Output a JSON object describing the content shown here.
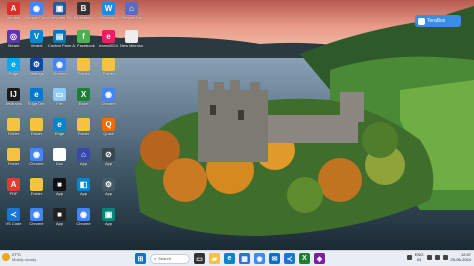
{
  "desktop": {
    "icons": [
      {
        "label": "Acrobat",
        "color": "#d93025",
        "glyph": "A",
        "icon": "pdf-icon"
      },
      {
        "label": "Google Chrome",
        "color": "#4285f4",
        "glyph": "◉",
        "icon": "chrome-icon"
      },
      {
        "label": "Computer Fest",
        "color": "#2b579a",
        "glyph": "▣",
        "icon": "app-icon"
      },
      {
        "label": "Bluestacks",
        "color": "#333333",
        "glyph": "B",
        "icon": "bluestacks-icon"
      },
      {
        "label": "WhatsApp",
        "color": "#1e88e5",
        "glyph": "W",
        "icon": "app-icon"
      },
      {
        "label": "Recycle Bin",
        "color": "#5c6bc0",
        "glyph": "⌂",
        "icon": "recycle-bin-icon"
      },
      {
        "label": "Steam",
        "color": "#5e35b1",
        "glyph": "◎",
        "icon": "steam-icon"
      },
      {
        "label": "Vivaldi",
        "color": "#0288d1",
        "glyph": "V",
        "icon": "app-icon"
      },
      {
        "label": "Control Panel",
        "color": "#0277bd",
        "glyph": "▤",
        "icon": "control-panel-icon"
      },
      {
        "label": "A. Facebook",
        "color": "#4caf50",
        "glyph": "f",
        "icon": "app-icon"
      },
      {
        "label": "exam2024",
        "color": "#e91e63",
        "glyph": "e",
        "icon": "folder-icon"
      },
      {
        "label": "New Microsoft",
        "color": "#eeeeee",
        "glyph": "",
        "icon": "document-icon"
      },
      {
        "label": "Edge",
        "color": "#03a9f4",
        "glyph": "e",
        "icon": "edge-icon"
      },
      {
        "label": "Settings",
        "color": "#0d47a1",
        "glyph": "⚙",
        "icon": "settings-icon"
      },
      {
        "label": "Chrome",
        "color": "#4285f4",
        "glyph": "◉",
        "icon": "chrome-icon"
      },
      {
        "label": "Folder",
        "color": "#f5c242",
        "glyph": "",
        "icon": "folder-icon"
      },
      {
        "label": "Folder",
        "color": "#f5c242",
        "glyph": "",
        "icon": "folder-icon"
      },
      {
        "label": "JetBrains",
        "color": "#1a1a1a",
        "glyph": "IJ",
        "icon": "jetbrains-icon"
      },
      {
        "label": "Edge Dev",
        "color": "#0078d4",
        "glyph": "e",
        "icon": "edge-icon"
      },
      {
        "label": "File",
        "color": "#90caf9",
        "glyph": "▭",
        "icon": "app-icon"
      },
      {
        "label": "Excel",
        "color": "#1e7e34",
        "glyph": "X",
        "icon": "excel-icon"
      },
      {
        "label": "Chrome",
        "color": "#4285f4",
        "glyph": "◉",
        "icon": "chrome-icon"
      },
      {
        "label": "Folder",
        "color": "#f5c242",
        "glyph": "",
        "icon": "folder-icon"
      },
      {
        "label": "Folder",
        "color": "#f5c242",
        "glyph": "",
        "icon": "folder-icon"
      },
      {
        "label": "Edge",
        "color": "#0a84c9",
        "glyph": "e",
        "icon": "edge-icon"
      },
      {
        "label": "Folder",
        "color": "#f5c242",
        "glyph": "",
        "icon": "folder-icon"
      },
      {
        "label": "Quick",
        "color": "#ef6c00",
        "glyph": "Q",
        "icon": "app-icon"
      },
      {
        "label": "Folder",
        "color": "#f5c242",
        "glyph": "",
        "icon": "folder-icon"
      },
      {
        "label": "Chrome",
        "color": "#4285f4",
        "glyph": "◉",
        "icon": "chrome-icon"
      },
      {
        "label": "Doc",
        "color": "#ffffff",
        "glyph": "",
        "icon": "document-icon"
      },
      {
        "label": "App",
        "color": "#3949ab",
        "glyph": "⌂",
        "icon": "app-icon"
      },
      {
        "label": "App",
        "color": "#37474f",
        "glyph": "⊘",
        "icon": "app-icon"
      },
      {
        "label": "PDF",
        "color": "#e53935",
        "glyph": "A",
        "icon": "pdf-icon"
      },
      {
        "label": "Folder",
        "color": "#f5c242",
        "glyph": "",
        "icon": "folder-icon"
      },
      {
        "label": "App",
        "color": "#111111",
        "glyph": "■",
        "icon": "app-icon"
      },
      {
        "label": "App",
        "color": "#0288d1",
        "glyph": "◧",
        "icon": "app-icon"
      },
      {
        "label": "App",
        "color": "#455a64",
        "glyph": "⚙",
        "icon": "app-icon"
      },
      {
        "label": "VS Code",
        "color": "#1976d2",
        "glyph": "≺",
        "icon": "vscode-icon"
      },
      {
        "label": "Chrome",
        "color": "#4285f4",
        "glyph": "◉",
        "icon": "chrome-icon"
      },
      {
        "label": "App",
        "color": "#212121",
        "glyph": "■",
        "icon": "app-icon"
      },
      {
        "label": "Chrome",
        "color": "#4285f4",
        "glyph": "◉",
        "icon": "chrome-icon"
      },
      {
        "label": "App",
        "color": "#00897b",
        "glyph": "▣",
        "icon": "app-icon"
      },
      {
        "label": "App",
        "color": "#1565c0",
        "glyph": "▭",
        "icon": "app-icon"
      },
      {
        "label": "Chrome",
        "color": "#4285f4",
        "glyph": "◉",
        "icon": "chrome-icon"
      },
      {
        "label": "Chart",
        "color": "#fdd835",
        "glyph": "▮",
        "icon": "chart-icon"
      }
    ]
  },
  "terabox": {
    "label": "TeraBox",
    "icon": "terabox-icon"
  },
  "taskbar": {
    "weather": {
      "temp": "27°C",
      "condition": "Mostly cloudy"
    },
    "search_placeholder": "Search",
    "apps": [
      {
        "name": "start",
        "glyph": "⊞",
        "color": "#0078d4",
        "icon": "windows-start-icon"
      },
      {
        "name": "task-view",
        "glyph": "▭",
        "color": "#333333",
        "icon": "task-view-icon"
      },
      {
        "name": "file-explorer",
        "glyph": "▰",
        "color": "#f5c242",
        "icon": "folder-icon"
      },
      {
        "name": "edge",
        "glyph": "e",
        "color": "#0a84c9",
        "icon": "edge-icon"
      },
      {
        "name": "store",
        "glyph": "▦",
        "color": "#2d6fdb",
        "icon": "store-icon"
      },
      {
        "name": "chrome",
        "glyph": "◉",
        "color": "#4285f4",
        "icon": "chrome-icon"
      },
      {
        "name": "mail",
        "glyph": "✉",
        "color": "#0a6ed1",
        "icon": "mail-icon"
      },
      {
        "name": "vscode",
        "glyph": "≺",
        "color": "#1976d2",
        "icon": "vscode-icon"
      },
      {
        "name": "excel",
        "glyph": "X",
        "color": "#1e7e34",
        "icon": "excel-icon"
      },
      {
        "name": "app",
        "glyph": "◈",
        "color": "#7b1fa2",
        "icon": "app-icon"
      }
    ],
    "tray": {
      "lang_top": "ENG",
      "lang_bottom": "IN",
      "time": "12:57",
      "date": "29-06-2024"
    }
  }
}
